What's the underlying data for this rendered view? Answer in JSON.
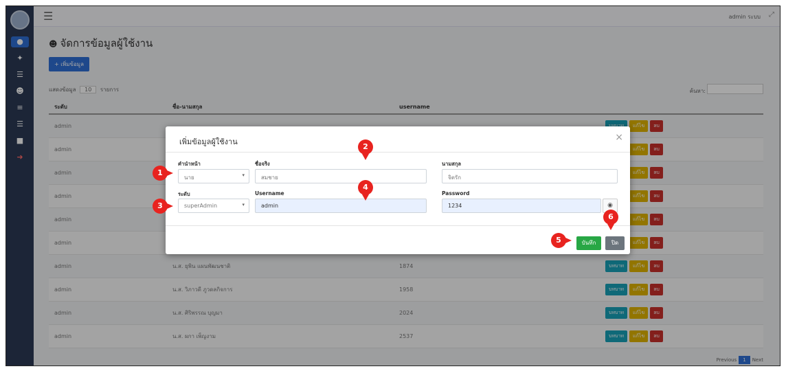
{
  "topbar": {
    "user_name": "admin ระบบ"
  },
  "page": {
    "title": "จัดการข้อมูลผู้ใช้งาน",
    "add_button": "+ เพิ่มข้อมูล"
  },
  "table_controls": {
    "show_prefix": "แสดงข้อมูล",
    "page_size": "10",
    "show_suffix": "รายการ",
    "search_label": "ค้นหา:"
  },
  "table": {
    "headers": [
      "ระดับ",
      "ชื่อ-นามสกุล",
      "username",
      ""
    ],
    "rows": [
      {
        "level": "admin",
        "name": "",
        "username": ""
      },
      {
        "level": "admin",
        "name": "",
        "username": ""
      },
      {
        "level": "admin",
        "name": "",
        "username": ""
      },
      {
        "level": "admin",
        "name": "",
        "username": ""
      },
      {
        "level": "admin",
        "name": "",
        "username": ""
      },
      {
        "level": "admin",
        "name": "",
        "username": ""
      },
      {
        "level": "admin",
        "name": "น.ส. ยุพิน แผนพัฒนชาติ",
        "username": "1874"
      },
      {
        "level": "admin",
        "name": "น.ส. วิภาวดี ภูวดลกิจการ",
        "username": "1958"
      },
      {
        "level": "admin",
        "name": "น.ส. ศิริพรรณ บุญมา",
        "username": "2024"
      },
      {
        "level": "admin",
        "name": "น.ส. ผกา เพ็ญงาม",
        "username": "2537"
      }
    ],
    "action_labels": {
      "view": "บทบาท",
      "edit": "แก้ไข",
      "delete": "ลบ"
    }
  },
  "modal": {
    "title": "เพิ่มข้อมูลผู้ใช้งาน",
    "close_icon": "×",
    "labels": {
      "prefix": "คำนำหน้า",
      "first_name": "ชื่อจริง",
      "last_name": "นามสกุล",
      "level": "ระดับ",
      "username": "Username",
      "password": "Password"
    },
    "values": {
      "prefix": "นาย",
      "first_name": "สมชาย",
      "last_name": "จิตรัก",
      "level": "superAdmin",
      "username": "admin",
      "password": "1234"
    },
    "save_button": "บันทึก",
    "close_button": "ปิด"
  },
  "markers": [
    "1",
    "2",
    "3",
    "4",
    "5",
    "6"
  ],
  "pager": {
    "prev": "Previous",
    "current": "1",
    "next": "Next"
  }
}
